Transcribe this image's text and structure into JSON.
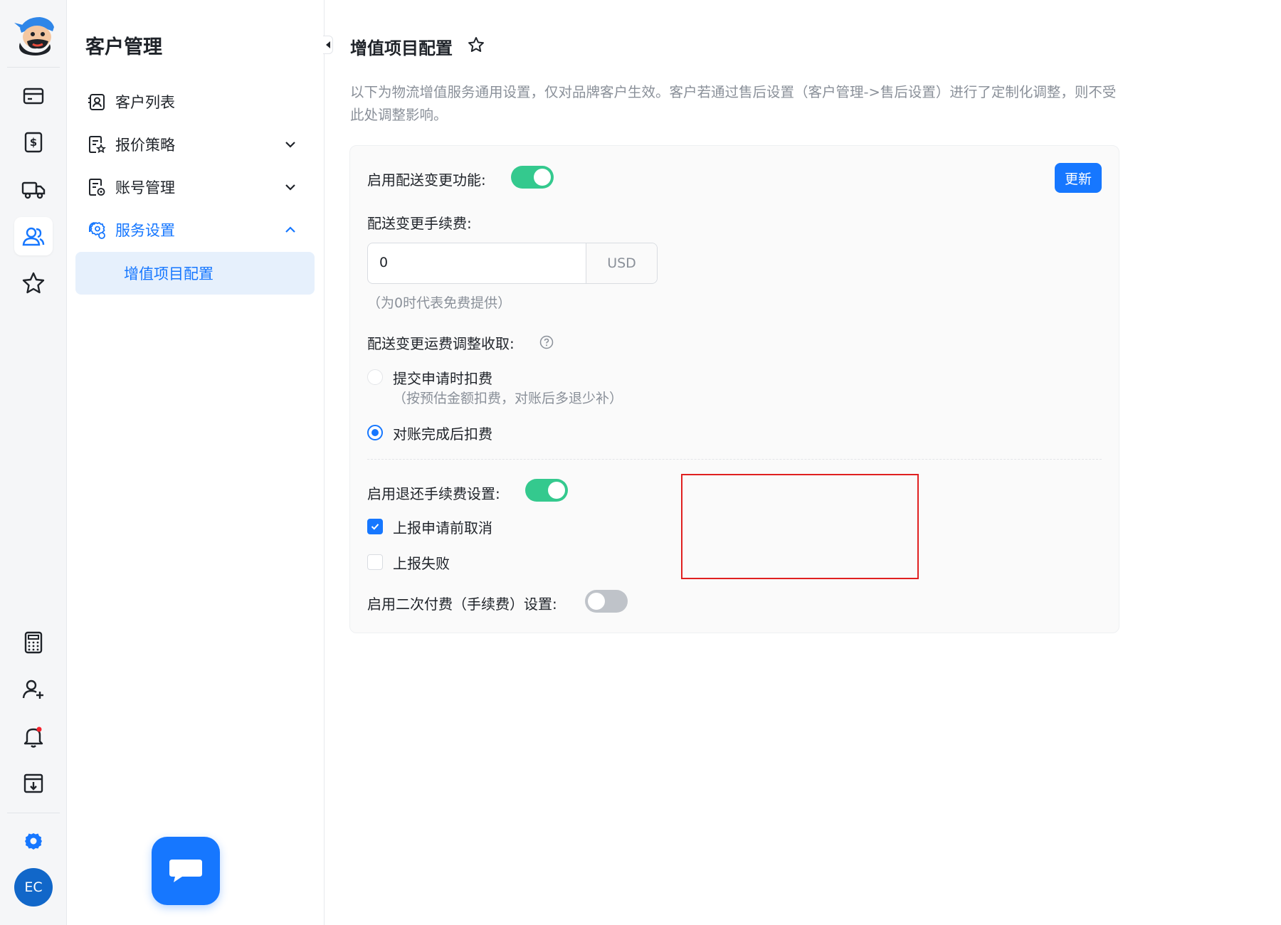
{
  "rail": {
    "avatar_initials": "EC",
    "icons": [
      "card-icon",
      "dollar-doc-icon",
      "truck-icon",
      "customers-icon",
      "star-icon",
      "calculator-icon",
      "add-user-icon",
      "bell-icon",
      "download-doc-icon",
      "gear-icon"
    ],
    "accent": "#1677ff"
  },
  "nav": {
    "title": "客户管理",
    "items": [
      {
        "label": "客户列表"
      },
      {
        "label": "报价策略"
      },
      {
        "label": "账号管理"
      },
      {
        "label": "服务设置"
      }
    ],
    "sub_item": "增值项目配置"
  },
  "main": {
    "title": "增值项目配置",
    "description": "以下为物流增值服务通用设置，仅对品牌客户生效。客户若通过售后设置（客户管理->售后设置）进行了定制化调整，则不受此处调整影响。",
    "update_button": "更新",
    "delivery_change_label": "启用配送变更功能:",
    "delivery_change_enabled": true,
    "fee_label": "配送变更手续费:",
    "fee_value": "0",
    "fee_currency": "USD",
    "fee_hint": "（为0时代表免费提供）",
    "freight_label": "配送变更运费调整收取:",
    "freight_options": [
      {
        "label": "提交申请时扣费",
        "note": "（按预估金额扣费，对账后多退少补）",
        "selected": false
      },
      {
        "label": "对账完成后扣费",
        "note": "",
        "selected": true
      }
    ],
    "refund_label": "启用退还手续费设置:",
    "refund_enabled": true,
    "refund_options": [
      {
        "label": "上报申请前取消",
        "checked": true
      },
      {
        "label": "上报失败",
        "checked": false
      }
    ],
    "second_payment_label": "启用二次付费（手续费）设置:",
    "second_payment_enabled": false
  },
  "colors": {
    "toggle_on": "#34c98e",
    "toggle_off": "#bfc3c9",
    "highlight": "#e02020"
  }
}
